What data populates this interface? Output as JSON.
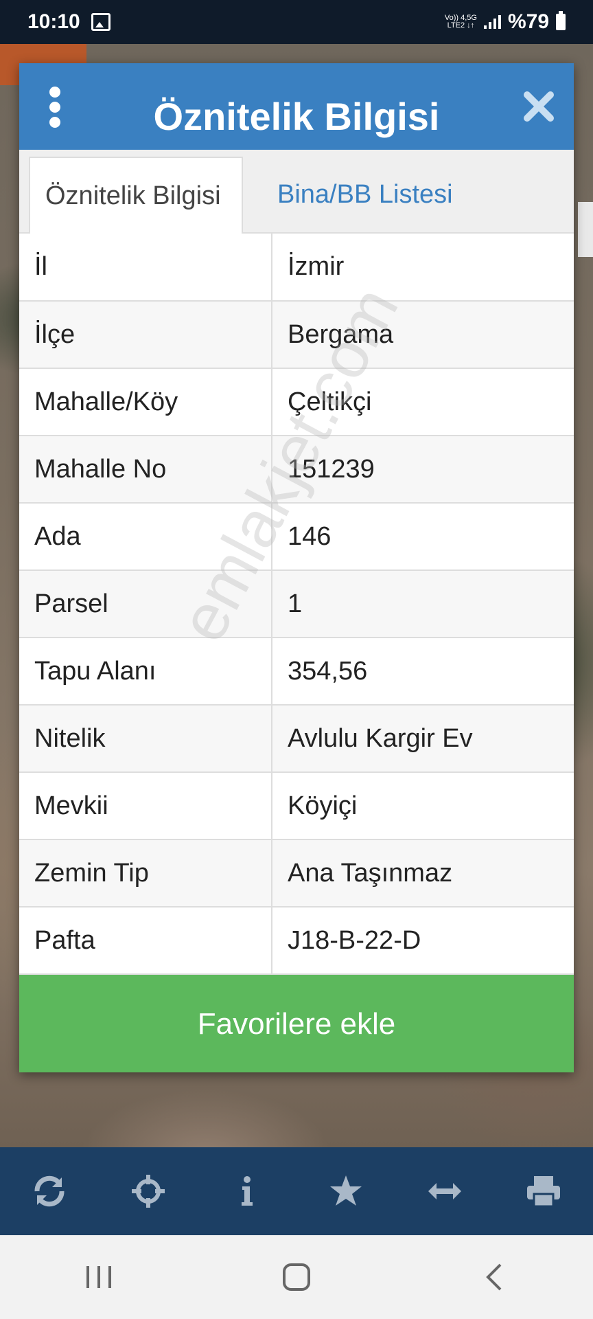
{
  "status_bar": {
    "time": "10:10",
    "network_top": "Vo)) 4,5G",
    "network_bottom": "LTE2 ↓↑",
    "battery": "%79"
  },
  "dialog": {
    "title": "Öznitelik Bilgisi",
    "tabs": [
      {
        "label": "Öznitelik Bilgisi",
        "active": true
      },
      {
        "label": "Bina/BB Listesi",
        "active": false
      }
    ],
    "rows": [
      {
        "key": "İl",
        "value": "İzmir"
      },
      {
        "key": "İlçe",
        "value": "Bergama"
      },
      {
        "key": "Mahalle/Köy",
        "value": "Çeltikçi"
      },
      {
        "key": "Mahalle No",
        "value": "151239"
      },
      {
        "key": "Ada",
        "value": "146"
      },
      {
        "key": "Parsel",
        "value": "1"
      },
      {
        "key": "Tapu Alanı",
        "value": "354,56"
      },
      {
        "key": "Nitelik",
        "value": "Avlulu Kargir Ev"
      },
      {
        "key": "Mevkii",
        "value": "Köyiçi"
      },
      {
        "key": "Zemin Tip",
        "value": "Ana Taşınmaz"
      },
      {
        "key": "Pafta",
        "value": "J18-B-22-D"
      }
    ],
    "favorite_button": "Favorilere ekle"
  },
  "watermark": "emlakjet.com",
  "toolbar": {
    "icons": [
      "refresh-icon",
      "crosshair-icon",
      "info-icon",
      "star-icon",
      "measure-icon",
      "print-icon"
    ]
  },
  "navbar": {
    "icons": [
      "recent-apps-icon",
      "home-icon",
      "back-icon"
    ]
  },
  "colors": {
    "header_blue": "#3a80c1",
    "button_green": "#5cb85c",
    "toolbar_navy": "#1c3f64"
  }
}
